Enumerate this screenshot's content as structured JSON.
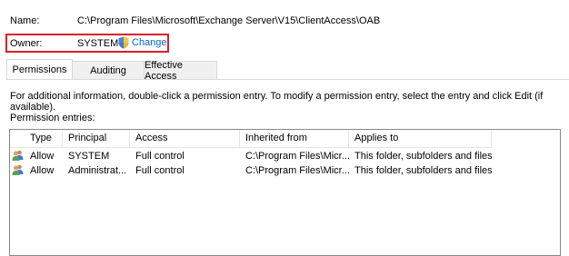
{
  "object": {
    "name_label": "Name:",
    "name_value": "C:\\Program Files\\Microsoft\\Exchange Server\\V15\\ClientAccess\\OAB",
    "owner_label": "Owner:",
    "owner_value": "SYSTEM",
    "change_label": "Change",
    "change_icon": "uac-shield-icon",
    "highlight_color": "#d9202a",
    "link_color": "#0066cc"
  },
  "tabs": [
    {
      "label": "Permissions",
      "active": true
    },
    {
      "label": "Auditing",
      "active": false
    },
    {
      "label": "Effective Access",
      "active": false
    }
  ],
  "info_text": "For additional information, double-click a permission entry. To modify a permission entry, select the entry and click Edit (if available).",
  "entries_label": "Permission entries:",
  "columns": [
    "Type",
    "Principal",
    "Access",
    "Inherited from",
    "Applies to"
  ],
  "entries": [
    {
      "icon": "users-icon",
      "type": "Allow",
      "principal": "SYSTEM",
      "access": "Full control",
      "inherited_from": "C:\\Program Files\\Micr...",
      "applies_to": "This folder, subfolders and files"
    },
    {
      "icon": "users-icon",
      "type": "Allow",
      "principal": "Administrat...",
      "access": "Full control",
      "inherited_from": "C:\\Program Files\\Micr...",
      "applies_to": "This folder, subfolders and files"
    }
  ]
}
